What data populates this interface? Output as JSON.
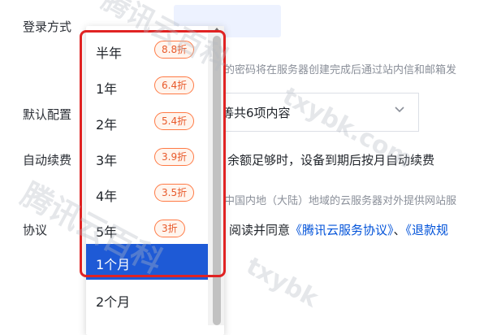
{
  "form": {
    "login_label": "登录方式",
    "login_hint": "的密码将在服务器创建完成后通过站内信和邮箱发",
    "default_config_label": "默认配置",
    "default_config_value": "等共6项内容",
    "auto_renew_label": "自动续费",
    "auto_renew_text": "余额足够时，设备到期后按月自动续费",
    "region_hint": "中国内地（大陆）地域的云服务器对外提供网站服",
    "agreement_label": "协议",
    "agreement_prefix": "阅读并同意",
    "agreement_link1": "《腾讯云服务协议》",
    "agreement_sep": "、",
    "agreement_link2": "《退款规"
  },
  "dropdown": {
    "items": [
      {
        "label": "半年",
        "badge": "8.8折"
      },
      {
        "label": "1年",
        "badge": "6.4折"
      },
      {
        "label": "2年",
        "badge": "5.4折"
      },
      {
        "label": "3年",
        "badge": "3.9折"
      },
      {
        "label": "4年",
        "badge": "3.5折"
      },
      {
        "label": "5年",
        "badge": "3折"
      },
      {
        "label": "1个月",
        "selected": true
      },
      {
        "label": "2个月"
      }
    ]
  },
  "watermark": {
    "text1": "腾讯云百科",
    "text2": "txybk.com",
    "text3": "腾讯云百科",
    "text4": "txybk"
  },
  "colors": {
    "selected_bg": "#1e5ad6",
    "badge_border": "#ff7a45",
    "highlight": "#e02323",
    "link": "#0052d9"
  },
  "icons": {
    "select_chevron": "chevron-down-icon",
    "scroll_up": "arrow-up-icon"
  }
}
